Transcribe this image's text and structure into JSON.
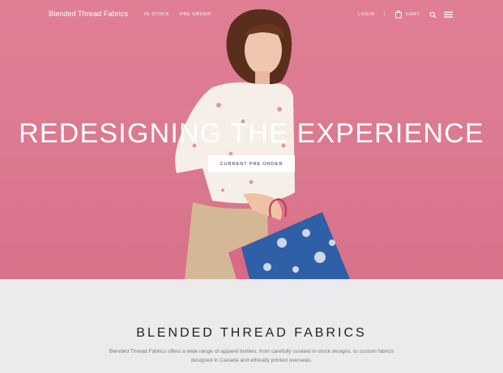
{
  "nav": {
    "brand": "Blended Thread Fabrics",
    "links": [
      "IN STOCK",
      "PRE ORDER"
    ],
    "login": "LOGIN",
    "separator": "|",
    "cart": "CART",
    "icons": [
      "cart-icon",
      "search-icon",
      "menu-icon"
    ]
  },
  "hero": {
    "title": "REDESIGNING THE EXPERIENCE",
    "button": "CURRENT PRE ORDER",
    "background_color": "#dc7b91"
  },
  "about": {
    "title": "BLENDED THREAD FABRICS",
    "description_line1": "Blended Thread Fabrics offers a wide range of apparel textiles, from carefully curated in-stock designs, to custom fabrics",
    "description_line2": "designed in Canada and ethically printed overseas."
  }
}
